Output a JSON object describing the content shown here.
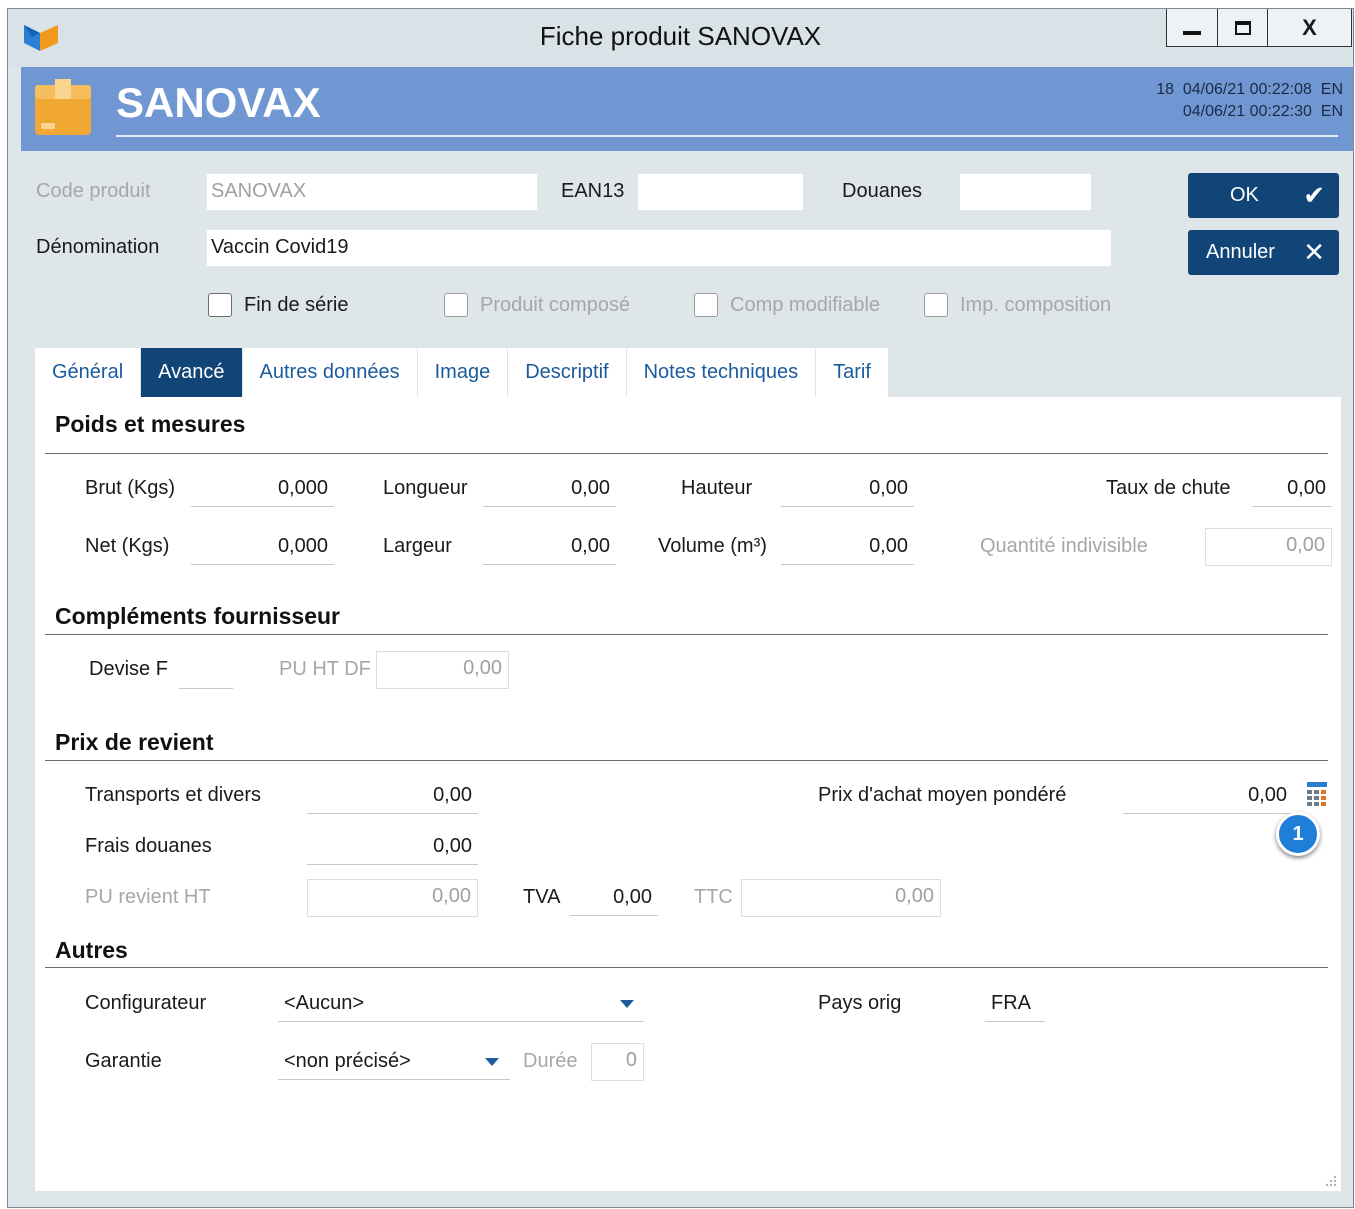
{
  "window": {
    "title": "Fiche produit SANOVAX",
    "controls": {
      "minimize": "▁",
      "maximize": "☐",
      "close": "X"
    }
  },
  "header": {
    "product_name": "SANOVAX",
    "meta_line1": "18  04/06/21 00:22:08  EN",
    "meta_line2": "04/06/21 00:22:30  EN"
  },
  "form": {
    "code_produit_label": "Code produit",
    "code_produit_value": "SANOVAX",
    "ean13_label": "EAN13",
    "ean13_value": "",
    "douanes_label": "Douanes",
    "douanes_value": "",
    "denomination_label": "Dénomination",
    "denomination_value": "Vaccin Covid19"
  },
  "buttons": {
    "ok": "OK",
    "annuler": "Annuler"
  },
  "checkboxes": {
    "fin_de_serie": "Fin de série",
    "produit_compose": "Produit composé",
    "comp_modifiable": "Comp modifiable",
    "imp_composition": "Imp. composition"
  },
  "tabs": [
    "Général",
    "Avancé",
    "Autres données",
    "Image",
    "Descriptif",
    "Notes techniques",
    "Tarif"
  ],
  "active_tab": "Avancé",
  "poids": {
    "title": "Poids et mesures",
    "brut_label": "Brut (Kgs)",
    "brut_value": "0,000",
    "net_label": "Net (Kgs)",
    "net_value": "0,000",
    "longueur_label": "Longueur",
    "longueur_value": "0,00",
    "largeur_label": "Largeur",
    "largeur_value": "0,00",
    "hauteur_label": "Hauteur",
    "hauteur_value": "0,00",
    "volume_label": "Volume (m³)",
    "volume_value": "0,00",
    "taux_chute_label": "Taux de chute",
    "taux_chute_value": "0,00",
    "qte_indivisible_label": "Quantité indivisible",
    "qte_indivisible_value": "0,00"
  },
  "fournisseur": {
    "title": "Compléments fournisseur",
    "devise_label": "Devise F",
    "devise_value": "",
    "pu_ht_df_label": "PU HT DF",
    "pu_ht_df_value": "0,00"
  },
  "revient": {
    "title": "Prix de revient",
    "transports_label": "Transports et divers",
    "transports_value": "0,00",
    "frais_douanes_label": "Frais douanes",
    "frais_douanes_value": "0,00",
    "pu_revient_label": "PU revient HT",
    "pu_revient_value": "0,00",
    "tva_label": "TVA",
    "tva_value": "0,00",
    "ttc_label": "TTC",
    "ttc_value": "0,00",
    "pamp_label": "Prix d'achat moyen pondéré",
    "pamp_value": "0,00",
    "badge": "1"
  },
  "autres": {
    "title": "Autres",
    "configurateur_label": "Configurateur",
    "configurateur_value": "<Aucun>",
    "garantie_label": "Garantie",
    "garantie_value": "<non précisé>",
    "duree_label": "Durée",
    "duree_value": "0",
    "pays_label": "Pays orig",
    "pays_value": "FRA"
  },
  "colors": {
    "accent": "#124577",
    "header": "#7197d3",
    "tab_text": "#1b5b9c",
    "background": "#dfe6ea"
  },
  "icons": [
    "app-logo-icon",
    "box-icon",
    "check-icon",
    "close-icon",
    "calculator-icon",
    "dropdown-arrow-icon",
    "resize-grip-icon"
  ]
}
